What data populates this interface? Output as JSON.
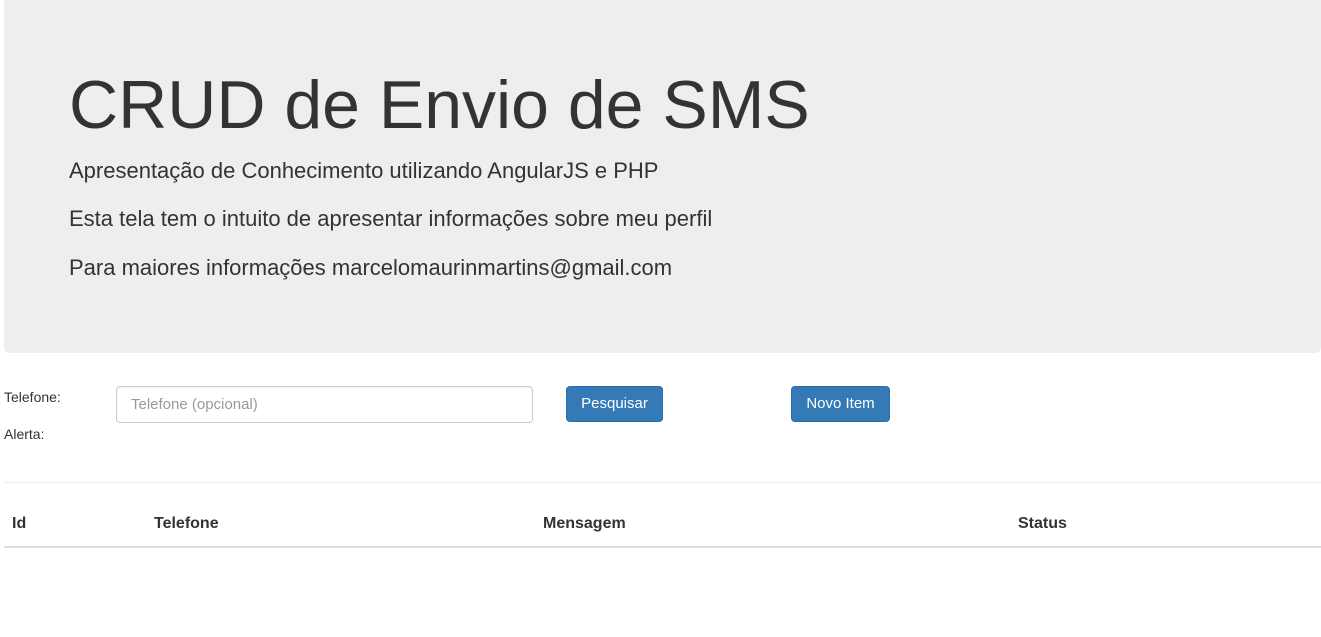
{
  "header": {
    "title": "CRUD de Envio de SMS",
    "lines": [
      "Apresentação de Conhecimento utilizando AngularJS e PHP",
      "Esta tela tem o intuito de apresentar informações sobre meu perfil",
      "Para maiores informações marcelomaurinmartins@gmail.com"
    ]
  },
  "form": {
    "telefone_label": "Telefone:",
    "alerta_label": "Alerta:",
    "telefone_input": {
      "value": "",
      "placeholder": "Telefone (opcional)"
    },
    "search_button": "Pesquisar",
    "new_button": "Novo Item"
  },
  "table": {
    "columns": [
      "Id",
      "Telefone",
      "Mensagem",
      "Status"
    ],
    "rows": []
  },
  "colors": {
    "jumbotron_bg": "#eeeeee",
    "primary_button": "#337ab7",
    "text": "#333333"
  }
}
